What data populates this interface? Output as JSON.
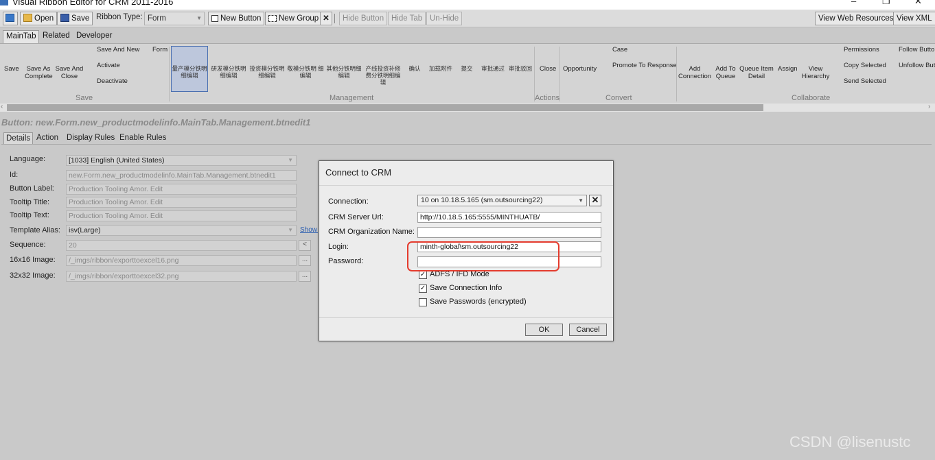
{
  "window": {
    "title": "Visual Ribbon Editor for CRM 2011-2016",
    "controls": [
      "–",
      "❐",
      "✕"
    ]
  },
  "toolbar": {
    "open": "Open",
    "save": "Save",
    "ribbon_type_label": "Ribbon Type:",
    "ribbon_type_value": "Form",
    "new_button": "New Button",
    "new_group": "New Group",
    "delete": "✕",
    "hide_button": "Hide Button",
    "hide_tab": "Hide Tab",
    "unhide": "Un-Hide",
    "view_web_resources": "View Web Resources",
    "view_xml": "View XML"
  },
  "tabs": [
    "MainTab",
    "Related",
    "Developer"
  ],
  "ribbon": {
    "save_group": {
      "label": "Save",
      "buttons": [
        "Save",
        "Save As Complete",
        "Save And Close",
        "Save And New",
        "Activate",
        "Deactivate"
      ]
    },
    "management_group": {
      "label": "Management",
      "form": "Form",
      "buttons": [
        "量产模分铁明 细编辑",
        "研发模分铁明 细编辑",
        "投资模分铁明 细编辑",
        "敬模分铁明 细编辑",
        "其他分铁明细 编辑",
        "产线投资补修 费分铁明细编 辑",
        "确认",
        "加载附件",
        "提交",
        "审批通过",
        "审批驳回"
      ]
    },
    "actions_group": {
      "label": "Actions",
      "buttons": [
        "Close"
      ]
    },
    "convert_group": {
      "label": "Convert",
      "buttons": [
        "Opportunity",
        "Case",
        "Promote To Response"
      ]
    },
    "collaborate_group": {
      "label": "Collaborate",
      "buttons": [
        "Add Connection",
        "Add To Queue",
        "Queue Item Detail",
        "Assign",
        "View Hierarchy",
        "Permissions",
        "Copy Selected",
        "Send Selected",
        "Follow Butto",
        "Unfollow But"
      ]
    }
  },
  "selected_button_path": "Button: new.Form.new_productmodelinfo.MainTab.Management.btnedit1",
  "detail_tabs": [
    "Details",
    "Action",
    "Display Rules",
    "Enable Rules"
  ],
  "details": {
    "language_label": "Language:",
    "language": "[1033] English (United States)",
    "id_label": "Id:",
    "id": "new.Form.new_productmodelinfo.MainTab.Management.btnedit1",
    "button_label_label": "Button Label:",
    "button_label": "Production Tooling Amor. Edit",
    "tooltip_title_label": "Tooltip Title:",
    "tooltip_title": "Production Tooling Amor. Edit",
    "tooltip_text_label": "Tooltip Text:",
    "tooltip_text": "Production Tooling Amor. Edit",
    "template_alias_label": "Template Alias:",
    "template_alias": "isv(Large)",
    "show_link": "Show S",
    "sequence_label": "Sequence:",
    "sequence": "20",
    "image16_label": "16x16 Image:",
    "image16": "/_imgs/ribbon/exporttoexcel16.png",
    "image32_label": "32x32 Image:",
    "image32": "/_imgs/ribbon/exporttoexcel32.png",
    "browse": "..."
  },
  "dialog": {
    "title": "Connect to CRM",
    "connection_label": "Connection:",
    "connection": "10 on 10.18.5.165 (sm.outsourcing22)",
    "server_label": "CRM Server Url:",
    "server": "http://10.18.5.165:5555/MINTHUATB/",
    "org_label": "CRM Organization Name:",
    "org": "",
    "login_label": "Login:",
    "login": "minth-global\\sm.outsourcing22",
    "password_label": "Password:",
    "password": "",
    "adfs_label": "ADFS / IFD Mode",
    "adfs_checked": true,
    "save_conn_label": "Save Connection Info",
    "save_conn_checked": true,
    "save_pw_label": "Save Passwords (encrypted)",
    "save_pw_checked": false,
    "ok": "OK",
    "cancel": "Cancel"
  },
  "watermark": "CSDN @lisenustc",
  "colors": {
    "highlight": "#e43b2d",
    "accent": "#3b6fb6"
  }
}
